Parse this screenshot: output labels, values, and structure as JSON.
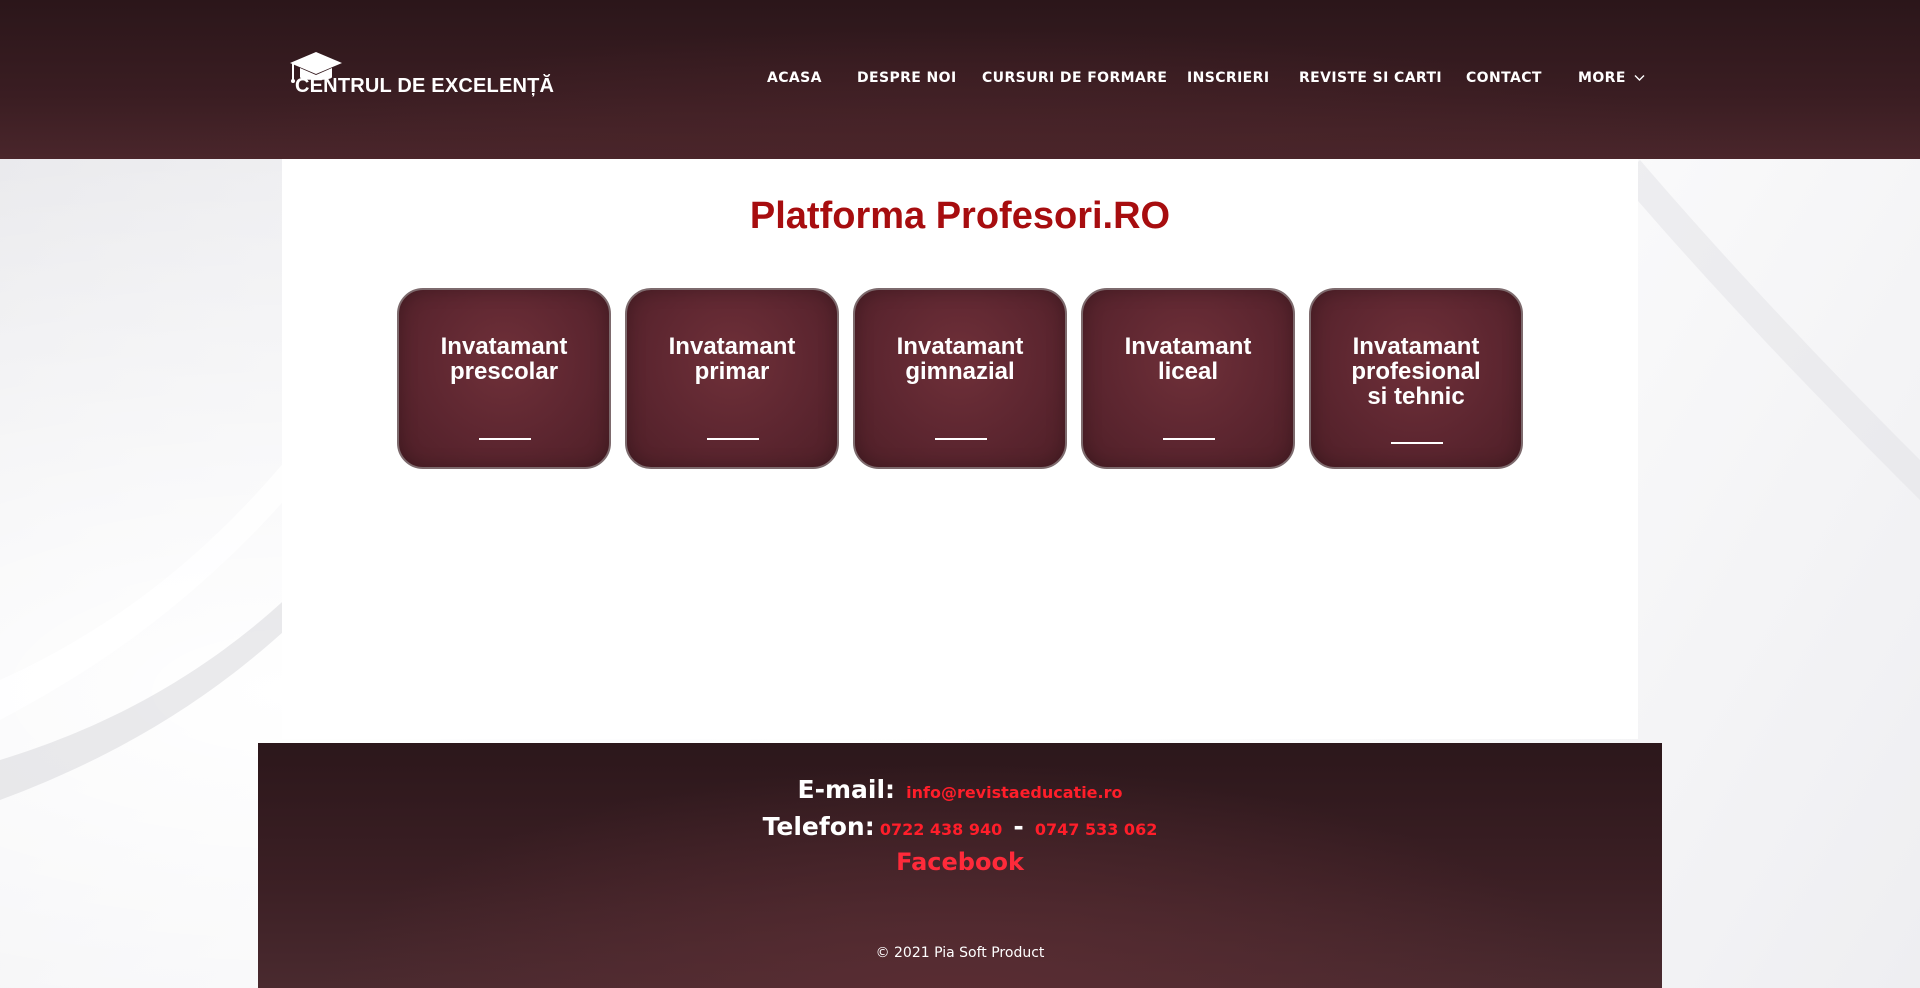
{
  "header": {
    "logo_text": "CENTRUL DE EXCELENȚĂ",
    "nav": {
      "acasa": "ACASA",
      "despre": "DESPRE NOI",
      "cursuri": "CURSURI DE FORMARE",
      "inscrieri": "INSCRIERI",
      "reviste": "REVISTE SI CARTI",
      "contact": "CONTACT",
      "more": "MORE"
    }
  },
  "main": {
    "title": "Platforma Profesori.RO",
    "cards": [
      {
        "label": "Invatamant\nprescolar"
      },
      {
        "label": "Invatamant\nprimar"
      },
      {
        "label": "Invatamant\ngimnazial"
      },
      {
        "label": "Invatamant\nliceal"
      },
      {
        "label": "Invatamant\nprofesional\nsi tehnic"
      }
    ]
  },
  "footer": {
    "email_label": "E-mail:",
    "email": "info@revistaeducatie.ro",
    "phone_label": "Telefon:",
    "phone1": "0722 438 940",
    "phone_sep": "-",
    "phone2": "0747 533 062",
    "facebook": "Facebook",
    "copyright": "© 2021 Pia Soft Product"
  },
  "colors": {
    "header_bg": "#3a1d22",
    "title_red": "#a70d0f",
    "card_bg": "#5d2630",
    "footer_link": "#ff1e2a"
  },
  "icons": {
    "logo": "graduation-cap-icon",
    "more": "chevron-down-icon"
  }
}
